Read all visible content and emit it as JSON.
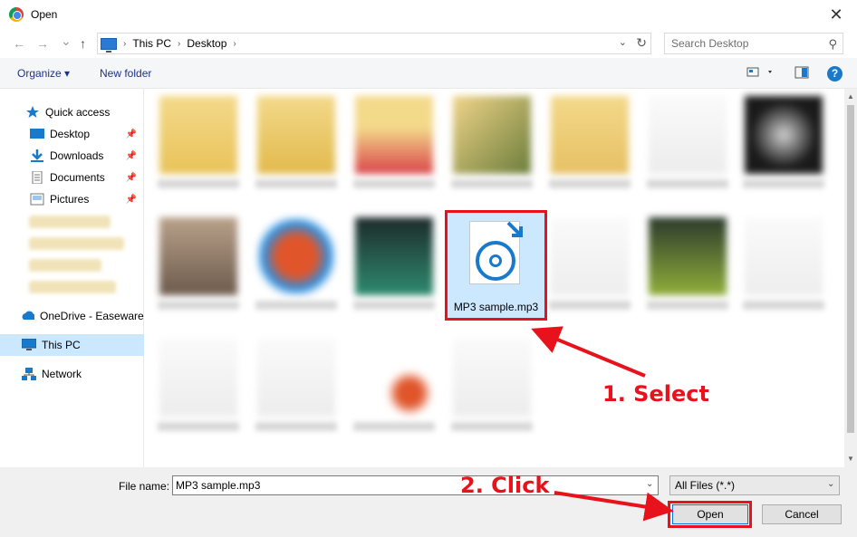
{
  "window": {
    "title": "Open",
    "close_glyph": "✕"
  },
  "nav": {
    "back": "←",
    "forward": "→",
    "recent": "⌄",
    "up": "↑"
  },
  "address": {
    "crumbs": [
      "This PC",
      "Desktop"
    ],
    "sep": "›"
  },
  "search": {
    "placeholder": "Search Desktop"
  },
  "toolbar": {
    "organize": "Organize ▾",
    "new_folder": "New folder"
  },
  "sidebar": {
    "items": [
      {
        "label": "Quick access",
        "icon": "star-icon"
      },
      {
        "label": "Desktop",
        "icon": "desktop-folder-icon",
        "pinned": true
      },
      {
        "label": "Downloads",
        "icon": "download-icon",
        "pinned": true
      },
      {
        "label": "Documents",
        "icon": "documents-icon",
        "pinned": true
      },
      {
        "label": "Pictures",
        "icon": "pictures-icon",
        "pinned": true
      },
      {
        "label": "OneDrive - Easeware",
        "icon": "cloud-icon"
      },
      {
        "label": "This PC",
        "icon": "computer-icon",
        "selected": true
      },
      {
        "label": "Network",
        "icon": "network-icon"
      }
    ]
  },
  "selected_file": {
    "name": "MP3 sample.mp3"
  },
  "bottom": {
    "file_name_label": "File name:",
    "file_name_value": "MP3 sample.mp3",
    "file_type": "All Files (*.*)",
    "open": "Open",
    "cancel": "Cancel"
  },
  "annotations": {
    "step1": "1. Select",
    "step2": "2. Click"
  },
  "colors": {
    "highlight": "#e8121c",
    "accent": "#1979ca",
    "selection": "#cce8ff"
  }
}
